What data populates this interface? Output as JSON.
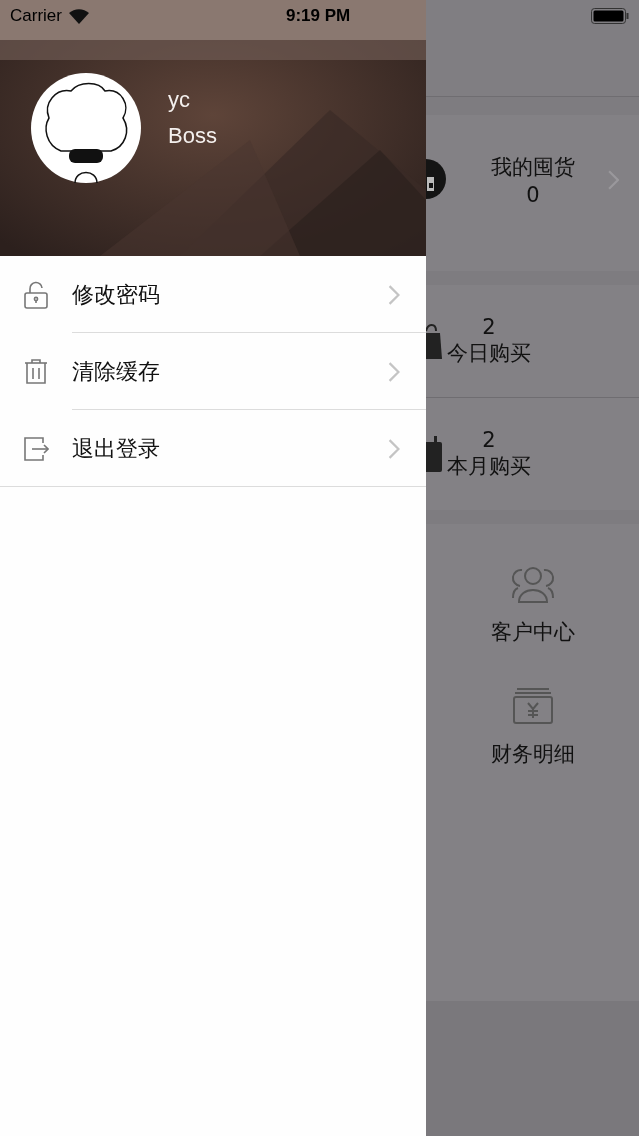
{
  "status_bar": {
    "carrier": "Carrier",
    "time": "9:19 PM"
  },
  "drawer": {
    "profile": {
      "name": "yc",
      "role": "Boss"
    },
    "menu": [
      {
        "kind": "lock",
        "label": "修改密码"
      },
      {
        "kind": "trash",
        "label": "清除缓存"
      },
      {
        "kind": "logout",
        "label": "退出登录"
      }
    ]
  },
  "background_screen": {
    "stock": {
      "label": "我的囤货",
      "count": "0"
    },
    "purchases": [
      {
        "kind": "bag",
        "count": "2",
        "label": "今日购买"
      },
      {
        "kind": "calendar",
        "count": "2",
        "label": "本月购买"
      }
    ],
    "shortcuts": [
      {
        "kind": "customers",
        "label": "客户中心"
      },
      {
        "kind": "finance",
        "label": "财务明细"
      }
    ]
  }
}
